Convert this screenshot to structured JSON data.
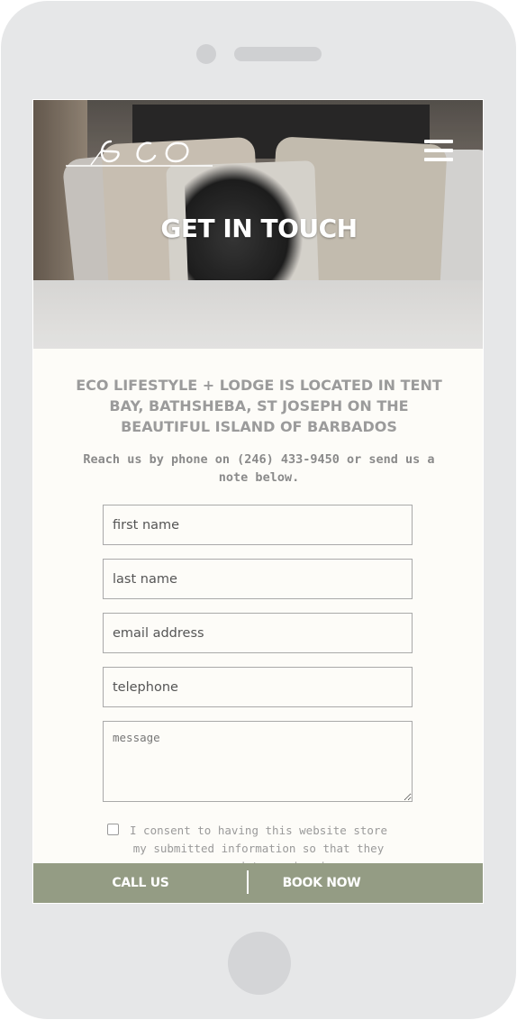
{
  "device": {
    "type": "smartphone"
  },
  "header": {
    "logo_alt": "eco",
    "menu_icon": "hamburger-menu-icon"
  },
  "hero": {
    "title": "GET IN TOUCH"
  },
  "intro": {
    "heading": "ECO LIFESTYLE + LODGE IS LOCATED IN TENT BAY, BATHSHEBA, ST JOSEPH ON THE BEAUTIFUL ISLAND OF BARBADOS",
    "contact_text": "Reach us by phone on (246) 433-9450 or send us a note below."
  },
  "form": {
    "first_name_placeholder": "first name",
    "last_name_placeholder": "last name",
    "email_placeholder": "email address",
    "telephone_placeholder": "telephone",
    "message_placeholder": "message",
    "consent_text": "I consent to having this website store my submitted information so that they can respond to my inquiry."
  },
  "bottom_bar": {
    "call_label": "CALL US",
    "book_label": "BOOK NOW"
  },
  "colors": {
    "background": "#fdfcf8",
    "heading_gray": "#9b9b9b",
    "bar_green": "#949c84",
    "phone_shell": "#e6e7e8"
  }
}
